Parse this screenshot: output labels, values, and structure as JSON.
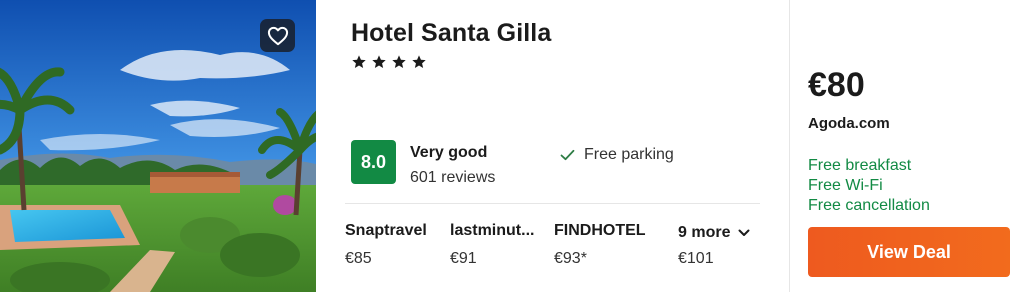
{
  "hotel": {
    "name": "Hotel Santa Gilla",
    "stars": 4
  },
  "rating": {
    "score": "8.0",
    "label": "Very good",
    "reviews": "601 reviews"
  },
  "amenity": {
    "icon": "checkmark-icon",
    "label": "Free parking"
  },
  "providers": [
    {
      "name": "Snaptravel",
      "price": "€85"
    },
    {
      "name": "lastminut...",
      "price": "€91"
    },
    {
      "name": "FINDHOTEL",
      "price": "€93*"
    }
  ],
  "more": {
    "label": "9 more",
    "price": "€101"
  },
  "deal": {
    "price": "€80",
    "site": "Agoda.com",
    "perks": [
      "Free breakfast",
      "Free Wi-Fi",
      "Free cancellation"
    ],
    "button_label": "View Deal"
  },
  "colors": {
    "score_bg": "#128a44",
    "perk_text": "#128a44",
    "button": "#f0621e"
  }
}
